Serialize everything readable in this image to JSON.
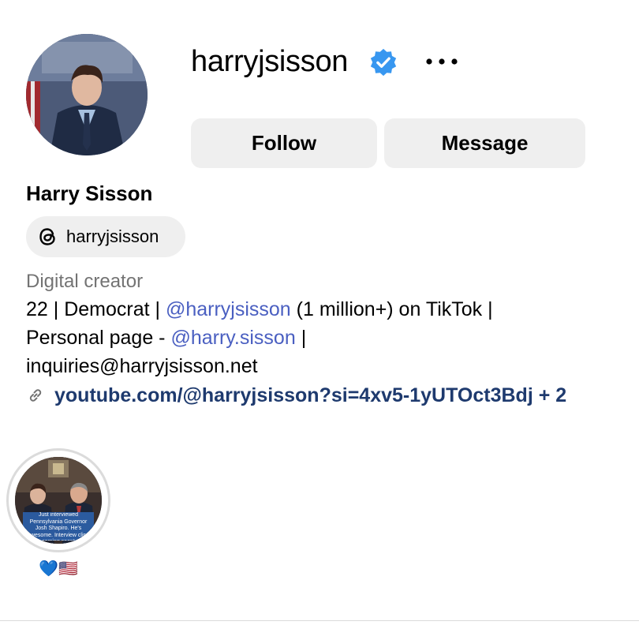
{
  "profile": {
    "username": "harryjsisson",
    "full_name": "Harry Sisson",
    "verified_icon": "verified-badge-icon",
    "more_icon": "ellipsis-icon",
    "threads_handle": "harryjsisson",
    "category": "Digital creator",
    "bio": {
      "line1_a": "22 | Democrat | ",
      "line1_mention": "@harryjsisson",
      "line1_b": " (1 million+) on TikTok |",
      "line2_a": "Personal page - ",
      "line2_mention": "@harry.sisson",
      "line2_b": " |",
      "line3": "inquiries@harryjsisson.net"
    },
    "link": "youtube.com/@harryjsisson?si=4xv5-1yUTOct3Bdj + 2"
  },
  "actions": {
    "follow_label": "Follow",
    "message_label": "Message"
  },
  "highlight": {
    "caption": "Just interviewed Pennsylvania Governor Josh Shapiro. He's awesome. Interview clips coming soon!",
    "label": "💙🇺🇸"
  },
  "colors": {
    "verified": "#3897f0",
    "mention": "#4a5fc1",
    "link": "#1e3a6e",
    "button_bg": "#efefef"
  }
}
